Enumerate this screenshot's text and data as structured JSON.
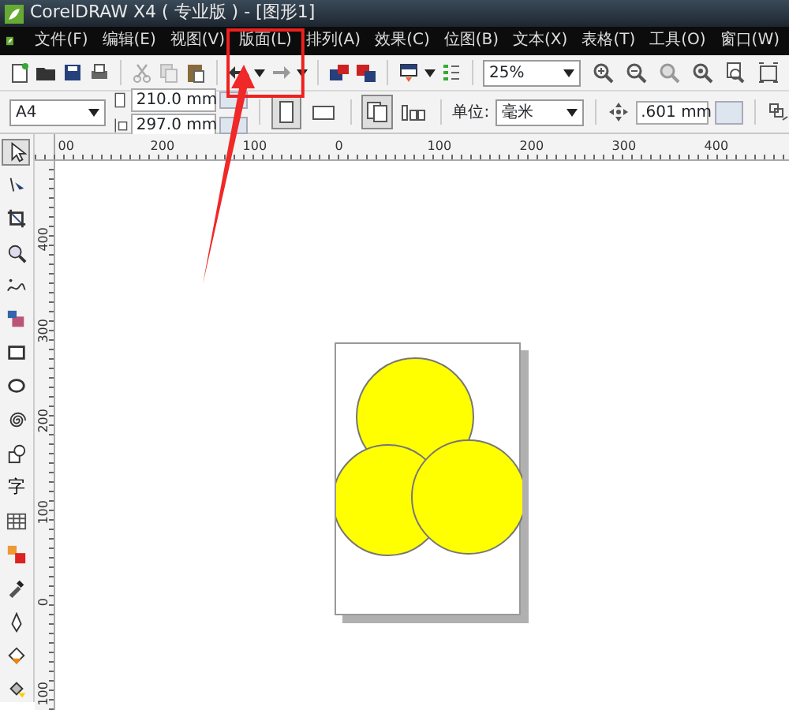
{
  "window": {
    "title": "CorelDRAW X4 ( 专业版 ) - [图形1]"
  },
  "menu": [
    {
      "label": "文件(F)"
    },
    {
      "label": "编辑(E)"
    },
    {
      "label": "视图(V)"
    },
    {
      "label": "版面(L)",
      "highlighted": true
    },
    {
      "label": "排列(A)"
    },
    {
      "label": "效果(C)"
    },
    {
      "label": "位图(B)"
    },
    {
      "label": "文本(X)"
    },
    {
      "label": "表格(T)"
    },
    {
      "label": "工具(O)"
    },
    {
      "label": "窗口(W)"
    }
  ],
  "toolbar": {
    "zoom": "25%"
  },
  "property_bar": {
    "paper": "A4",
    "width": "210.0 mm",
    "height": "297.0 mm",
    "orientation": [
      {
        "kind": "portrait",
        "selected": true
      },
      {
        "kind": "landscape",
        "selected": false
      }
    ],
    "page_scope": [
      {
        "kind": "all",
        "selected": true
      },
      {
        "kind": "current",
        "selected": false
      }
    ],
    "units_label": "单位:",
    "units": "毫米",
    "nudge": ".601 mm"
  },
  "ruler_h": [
    "00",
    "200",
    "100",
    "0",
    "100",
    "200",
    "300",
    "400"
  ],
  "ruler_v": [
    "400",
    "300",
    "200",
    "100",
    "0",
    "100"
  ],
  "toolbox": [
    {
      "kind": "pick",
      "selected": true
    },
    {
      "kind": "shape",
      "selected": false
    },
    {
      "kind": "crop",
      "selected": false
    },
    {
      "kind": "zoom",
      "selected": false
    },
    {
      "kind": "freehand",
      "selected": false
    },
    {
      "kind": "smartfill",
      "selected": false
    },
    {
      "kind": "rect",
      "selected": false
    },
    {
      "kind": "ellipse",
      "selected": false
    },
    {
      "kind": "spiral",
      "selected": false
    },
    {
      "kind": "shapes",
      "selected": false
    },
    {
      "kind": "text",
      "label": "字",
      "selected": false
    },
    {
      "kind": "table",
      "selected": false
    },
    {
      "kind": "blend",
      "selected": false
    },
    {
      "kind": "eyedropper",
      "selected": false
    },
    {
      "kind": "outline",
      "selected": false
    },
    {
      "kind": "fill",
      "selected": false
    },
    {
      "kind": "ifill",
      "selected": false
    }
  ],
  "document": {
    "shapes": [
      {
        "kind": "circle",
        "color": "#ffff00"
      },
      {
        "kind": "circle",
        "color": "#ffff00"
      },
      {
        "kind": "circle",
        "color": "#ffff00"
      }
    ]
  }
}
